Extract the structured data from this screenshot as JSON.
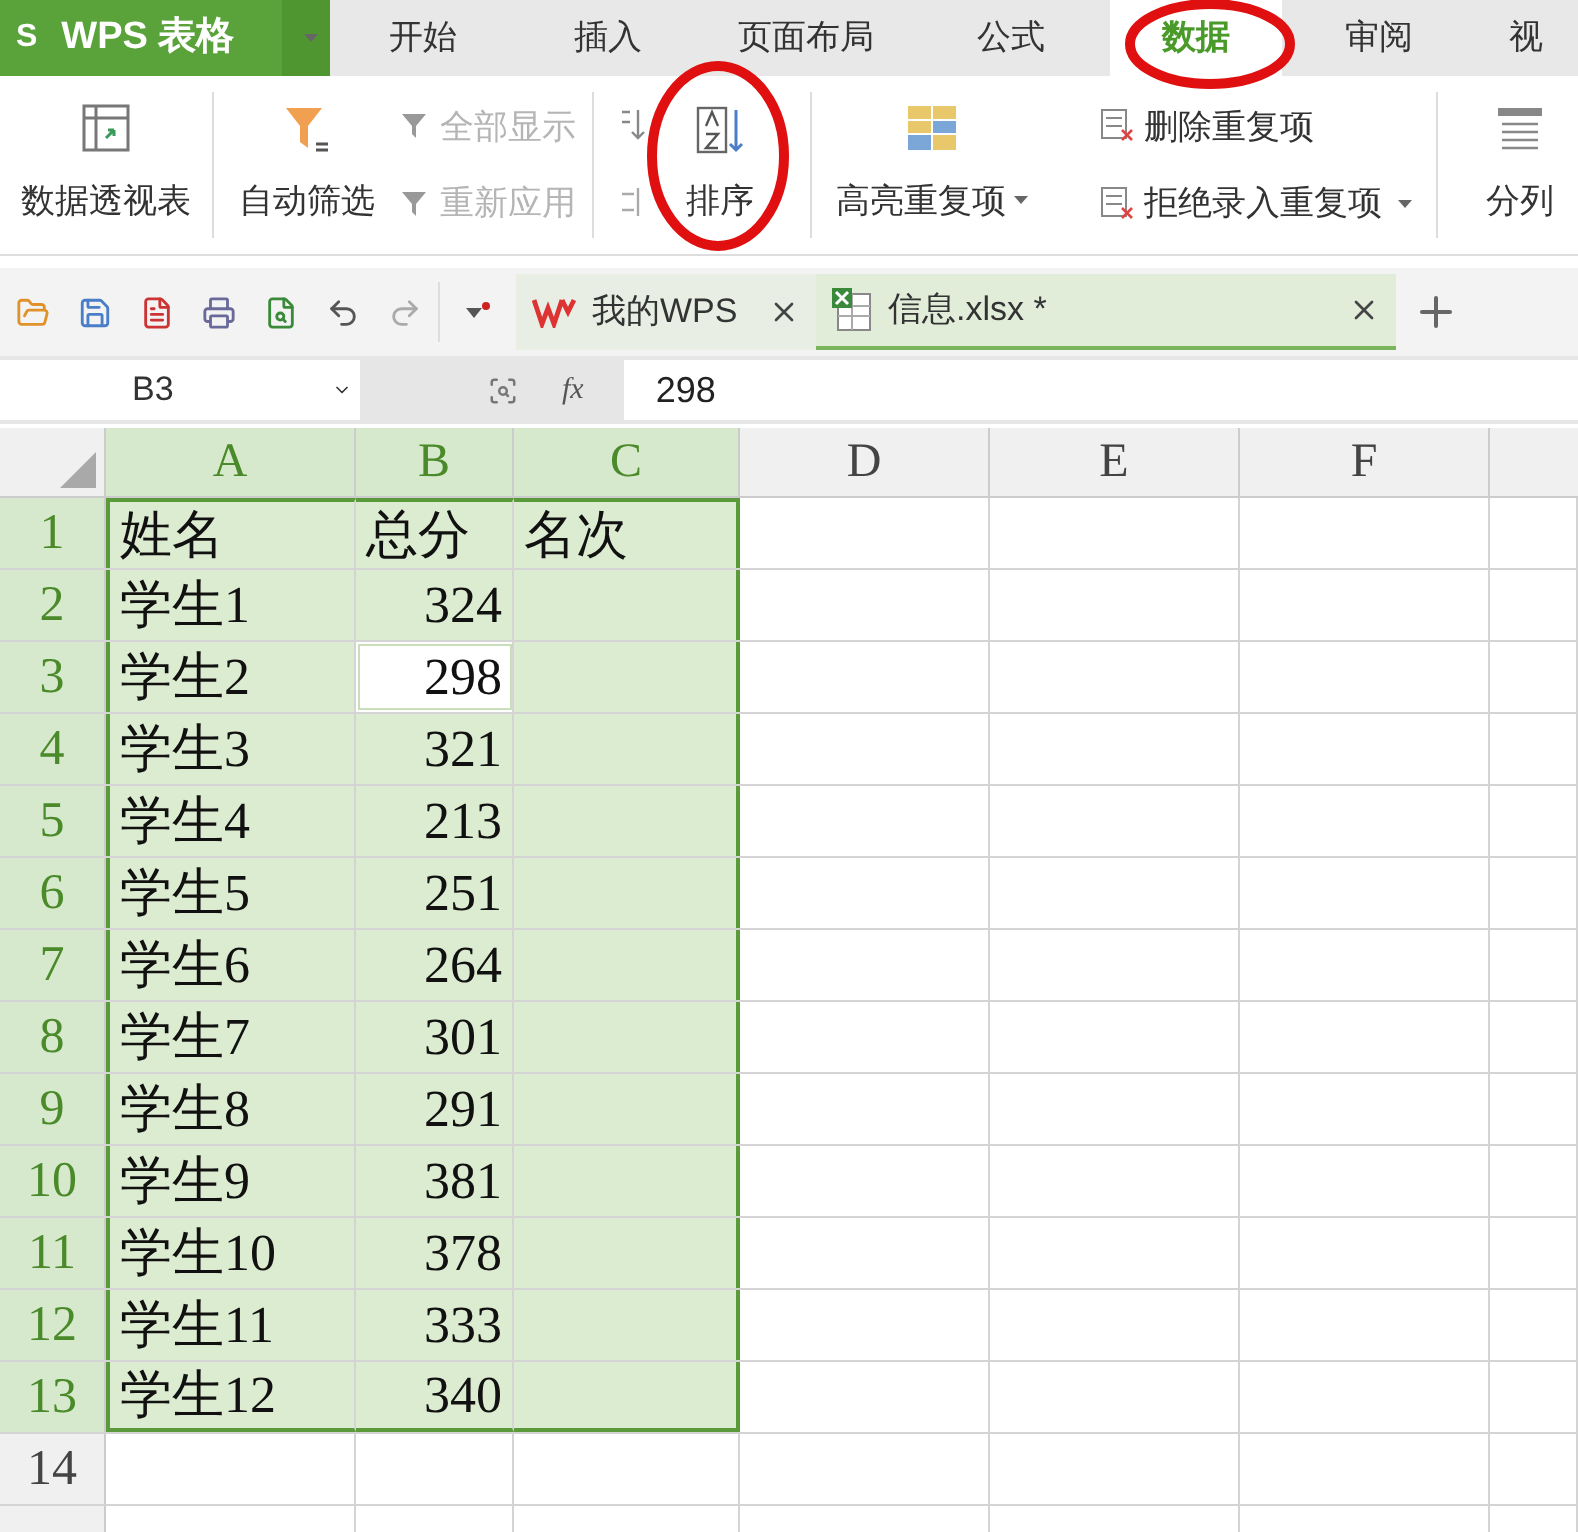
{
  "app": {
    "logo_mark": "S",
    "logo": "WPS 表格"
  },
  "menu_tabs": [
    {
      "label": "开始",
      "selected": false
    },
    {
      "label": "插入",
      "selected": false
    },
    {
      "label": "页面布局",
      "selected": false
    },
    {
      "label": "公式",
      "selected": false
    },
    {
      "label": "数据",
      "selected": true
    },
    {
      "label": "审阅",
      "selected": false
    },
    {
      "label": "视",
      "selected": false
    }
  ],
  "ribbon": {
    "pivot": {
      "label": "数据透视表"
    },
    "autofilter": {
      "label": "自动筛选"
    },
    "filter_small": [
      {
        "label": "全部显示",
        "disabled": true
      },
      {
        "label": "重新应用",
        "disabled": true
      }
    ],
    "sort": {
      "label": "排序"
    },
    "highlight": {
      "label": "高亮重复项"
    },
    "duplicates_small": [
      {
        "label": "删除重复项",
        "dropdown": false
      },
      {
        "label": "拒绝录入重复项",
        "dropdown": true
      }
    ],
    "split": {
      "label": "分列"
    }
  },
  "doc_tabs": [
    {
      "title": "我的WPS",
      "kind": "home",
      "selected": false
    },
    {
      "title": "信息.xlsx *",
      "kind": "sheet",
      "selected": true
    }
  ],
  "name_box": "B3",
  "fx_label": "fx",
  "formula": "298",
  "columns": [
    {
      "label": "A",
      "selected": true
    },
    {
      "label": "B",
      "selected": true
    },
    {
      "label": "C",
      "selected": true
    },
    {
      "label": "D",
      "selected": false
    },
    {
      "label": "E",
      "selected": false
    },
    {
      "label": "F",
      "selected": false
    }
  ],
  "rows": [
    {
      "number": "1",
      "selected": true,
      "cells": [
        {
          "text": "姓名",
          "active": false
        },
        {
          "text": "总分",
          "active": false
        },
        {
          "text": "名次",
          "active": false
        }
      ]
    },
    {
      "number": "2",
      "selected": true,
      "cells": [
        {
          "text": "学生1",
          "active": false
        },
        {
          "text": "324",
          "active": false
        },
        {
          "active": false
        }
      ]
    },
    {
      "number": "3",
      "selected": true,
      "cells": [
        {
          "text": "学生2",
          "active": false
        },
        {
          "text": "298",
          "active": true
        },
        {
          "active": false
        }
      ]
    },
    {
      "number": "4",
      "selected": true,
      "cells": [
        {
          "text": "学生3",
          "active": false
        },
        {
          "text": "321",
          "active": false
        },
        {
          "active": false
        }
      ]
    },
    {
      "number": "5",
      "selected": true,
      "cells": [
        {
          "text": "学生4",
          "active": false
        },
        {
          "text": "213",
          "active": false
        },
        {
          "active": false
        }
      ]
    },
    {
      "number": "6",
      "selected": true,
      "cells": [
        {
          "text": "学生5",
          "active": false
        },
        {
          "text": "251",
          "active": false
        },
        {
          "active": false
        }
      ]
    },
    {
      "number": "7",
      "selected": true,
      "cells": [
        {
          "text": "学生6",
          "active": false
        },
        {
          "text": "264",
          "active": false
        },
        {
          "active": false
        }
      ]
    },
    {
      "number": "8",
      "selected": true,
      "cells": [
        {
          "text": "学生7",
          "active": false
        },
        {
          "text": "301",
          "active": false
        },
        {
          "active": false
        }
      ]
    },
    {
      "number": "9",
      "selected": true,
      "cells": [
        {
          "text": "学生8",
          "active": false
        },
        {
          "text": "291",
          "active": false
        },
        {
          "active": false
        }
      ]
    },
    {
      "number": "10",
      "selected": true,
      "cells": [
        {
          "text": "学生9",
          "active": false
        },
        {
          "text": "381",
          "active": false
        },
        {
          "active": false
        }
      ]
    },
    {
      "number": "11",
      "selected": true,
      "cells": [
        {
          "text": "学生10",
          "active": false
        },
        {
          "text": "378",
          "active": false
        },
        {
          "active": false
        }
      ]
    },
    {
      "number": "12",
      "selected": true,
      "cells": [
        {
          "text": "学生11",
          "active": false
        },
        {
          "text": "333",
          "active": false
        },
        {
          "active": false
        }
      ]
    },
    {
      "number": "13",
      "selected": true,
      "cells": [
        {
          "text": "学生12",
          "active": false
        },
        {
          "text": "340",
          "active": false
        },
        {
          "active": false
        }
      ]
    },
    {
      "number": "14",
      "selected": false
    }
  ]
}
